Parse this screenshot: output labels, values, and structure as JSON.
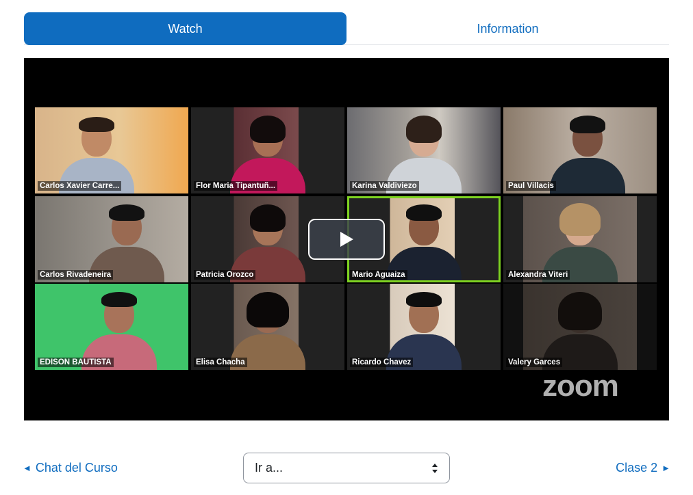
{
  "tabs": {
    "watch": "Watch",
    "information": "Information"
  },
  "video": {
    "logo": "zoom",
    "participants": [
      {
        "name": "Carlos Xavier Carre..."
      },
      {
        "name": "Flor Maria Tipantuñ..."
      },
      {
        "name": "Karina Valdiviezo"
      },
      {
        "name": "Paul Villacis"
      },
      {
        "name": "Carlos Rivadeneira"
      },
      {
        "name": "Patricia Orozco"
      },
      {
        "name": "Mario Aguaiza"
      },
      {
        "name": "Alexandra Viteri"
      },
      {
        "name": "EDISON BAUTISTA"
      },
      {
        "name": "Elisa Chacha"
      },
      {
        "name": "Ricardo Chavez"
      },
      {
        "name": "Valery Garces"
      }
    ],
    "speaking_color": "#7ed321"
  },
  "navigation": {
    "prev_label": "Chat del Curso",
    "next_label": "Clase 2",
    "jump_placeholder": "Ir a..."
  },
  "colors": {
    "accent": "#0f6cbf"
  }
}
